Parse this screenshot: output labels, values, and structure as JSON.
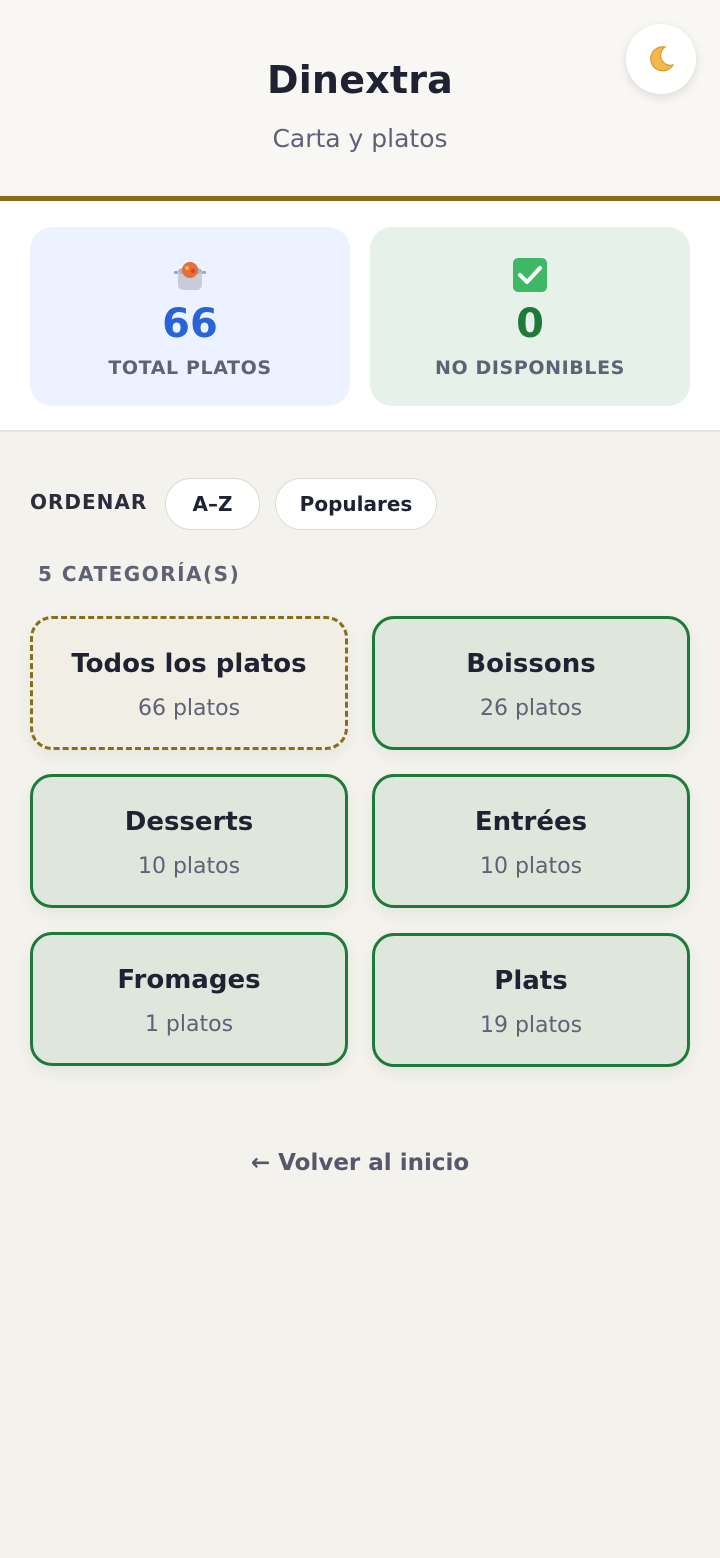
{
  "header": {
    "title": "Dinextra",
    "subtitle": "Carta y platos",
    "theme_toggle_icon": "moon-icon"
  },
  "stats": {
    "total": {
      "icon": "cooking-pot-icon",
      "value": "66",
      "label": "TOTAL PLATOS",
      "color": "#2a63d8"
    },
    "unavailable": {
      "icon": "check-box-icon",
      "value": "0",
      "label": "NO DISPONIBLES",
      "color": "#1d7a39"
    }
  },
  "sort": {
    "label": "ORDENAR",
    "options": [
      "A–Z",
      "Populares"
    ]
  },
  "categories": {
    "count_label": "5 CATEGORÍA(S)",
    "items": [
      {
        "name": "Todos los platos",
        "count": "66 platos",
        "style": "dashed",
        "accent": "#8a6d1a"
      },
      {
        "name": "Boissons",
        "count": "26 platos",
        "style": "solid",
        "accent": "#1d7a39"
      },
      {
        "name": "Desserts",
        "count": "10 platos",
        "style": "solid",
        "accent": "#1d7a39"
      },
      {
        "name": "Entrées",
        "count": "10 platos",
        "style": "solid",
        "accent": "#1d7a39"
      },
      {
        "name": "Fromages",
        "count": "1 platos",
        "style": "solid",
        "accent": "#1d7a39"
      },
      {
        "name": "Plats",
        "count": "19 platos",
        "style": "solid",
        "accent": "#1d7a39"
      }
    ]
  },
  "footer": {
    "back_link": "← Volver al inicio"
  }
}
